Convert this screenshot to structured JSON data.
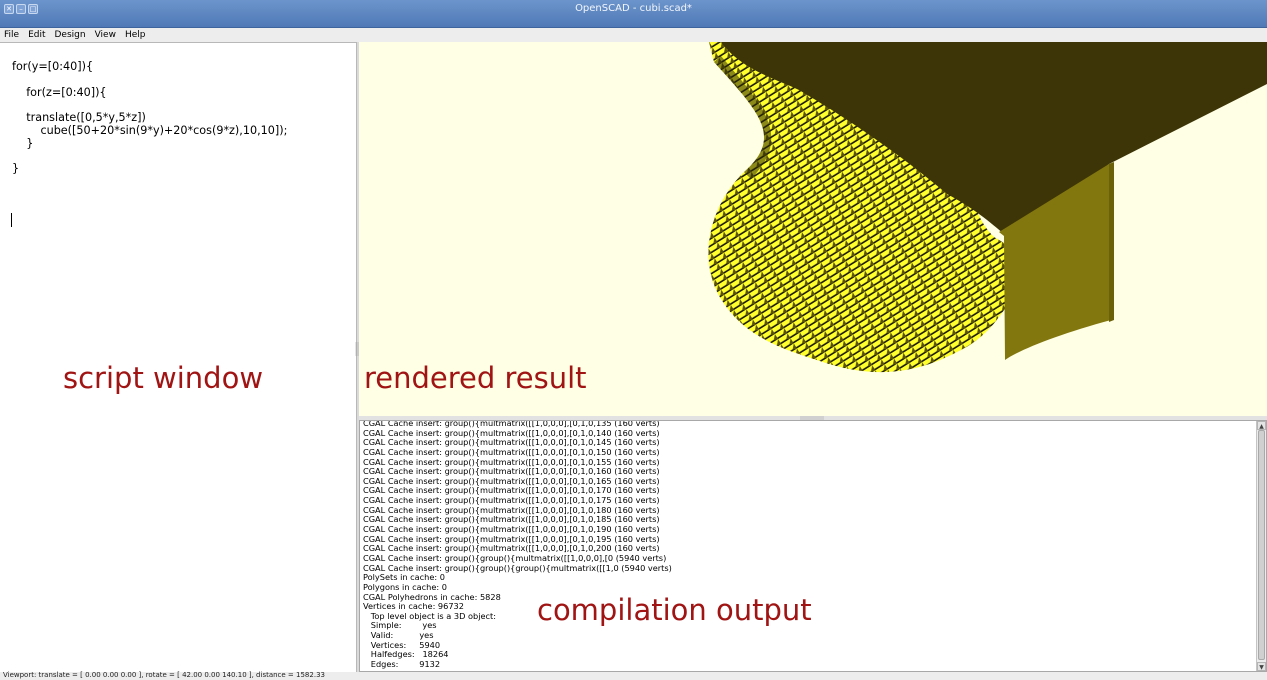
{
  "window": {
    "title": "OpenSCAD - cubi.scad*",
    "buttons": [
      "close-icon",
      "minimize-icon",
      "maximize-icon"
    ]
  },
  "menu": [
    "File",
    "Edit",
    "Design",
    "View",
    "Help"
  ],
  "editor": {
    "code": "for(y=[0:40]){\n\n    for(z=[0:40]){\n\n    translate([0,5*y,5*z])\n        cube([50+20*sin(9*y)+20*cos(9*z),10,10]);\n    }\n\n}"
  },
  "console": {
    "lines": [
      "CGAL Cache insert: group(){multmatrix([[1,0,0,0],[0,1,0,135 (160 verts)",
      "CGAL Cache insert: group(){multmatrix([[1,0,0,0],[0,1,0,140 (160 verts)",
      "CGAL Cache insert: group(){multmatrix([[1,0,0,0],[0,1,0,145 (160 verts)",
      "CGAL Cache insert: group(){multmatrix([[1,0,0,0],[0,1,0,150 (160 verts)",
      "CGAL Cache insert: group(){multmatrix([[1,0,0,0],[0,1,0,155 (160 verts)",
      "CGAL Cache insert: group(){multmatrix([[1,0,0,0],[0,1,0,160 (160 verts)",
      "CGAL Cache insert: group(){multmatrix([[1,0,0,0],[0,1,0,165 (160 verts)",
      "CGAL Cache insert: group(){multmatrix([[1,0,0,0],[0,1,0,170 (160 verts)",
      "CGAL Cache insert: group(){multmatrix([[1,0,0,0],[0,1,0,175 (160 verts)",
      "CGAL Cache insert: group(){multmatrix([[1,0,0,0],[0,1,0,180 (160 verts)",
      "CGAL Cache insert: group(){multmatrix([[1,0,0,0],[0,1,0,185 (160 verts)",
      "CGAL Cache insert: group(){multmatrix([[1,0,0,0],[0,1,0,190 (160 verts)",
      "CGAL Cache insert: group(){multmatrix([[1,0,0,0],[0,1,0,195 (160 verts)",
      "CGAL Cache insert: group(){multmatrix([[1,0,0,0],[0,1,0,200 (160 verts)",
      "CGAL Cache insert: group(){group(){multmatrix([[1,0,0,0],[0 (5940 verts)",
      "CGAL Cache insert: group(){group(){group(){multmatrix([[1,0 (5940 verts)",
      "PolySets in cache: 0",
      "Polygons in cache: 0",
      "CGAL Polyhedrons in cache: 5828",
      "Vertices in cache: 96732",
      "   Top level object is a 3D object:",
      "   Simple:        yes",
      "   Valid:          yes",
      "   Vertices:     5940",
      "   Halfedges:   18264",
      "   Edges:        9132"
    ]
  },
  "statusbar": "Viewport: translate = [ 0.00 0.00 0.00 ], rotate = [ 42.00 0.00 140.10 ], distance = 1582.33",
  "annotations": {
    "script": "script window",
    "render": "rendered result",
    "output": "compilation output"
  },
  "colors": {
    "viewport_bg": "#ffffe5",
    "face_yellow": "#ffff2e",
    "top_dark": "#3c3407",
    "side_olive": "#82760e",
    "annotation": "#a01414"
  }
}
